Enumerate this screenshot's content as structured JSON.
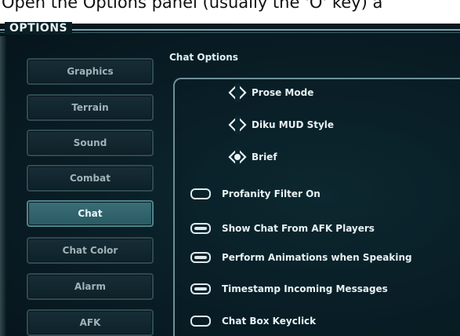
{
  "caption": "Open the Options panel (usually the 'O' key) a",
  "panel": {
    "title": "OPTIONS"
  },
  "sidebar": {
    "items": [
      {
        "label": "Graphics",
        "active": false
      },
      {
        "label": "Terrain",
        "active": false
      },
      {
        "label": "Sound",
        "active": false
      },
      {
        "label": "Combat",
        "active": false
      },
      {
        "label": "Chat",
        "active": true
      },
      {
        "label": "Chat Color",
        "active": false
      },
      {
        "label": "Alarm",
        "active": false
      },
      {
        "label": "AFK",
        "active": false
      }
    ]
  },
  "chat_options": {
    "heading": "Chat Options",
    "radios": [
      {
        "label": "Prose Mode",
        "selected": false
      },
      {
        "label": "Diku MUD Style",
        "selected": false
      },
      {
        "label": "Brief",
        "selected": true
      }
    ],
    "toggles": [
      {
        "label": "Profanity Filter On",
        "on": false
      },
      {
        "label": "Show Chat From AFK Players",
        "on": true
      },
      {
        "label": "Perform Animations when Speaking",
        "on": true
      },
      {
        "label": "Timestamp Incoming Messages",
        "on": true
      },
      {
        "label": "Chat Box Keyclick",
        "on": false
      }
    ]
  },
  "colors": {
    "accent": "#3a6e77",
    "text": "#e7f2f3",
    "button_text": "#9fb3b8"
  }
}
